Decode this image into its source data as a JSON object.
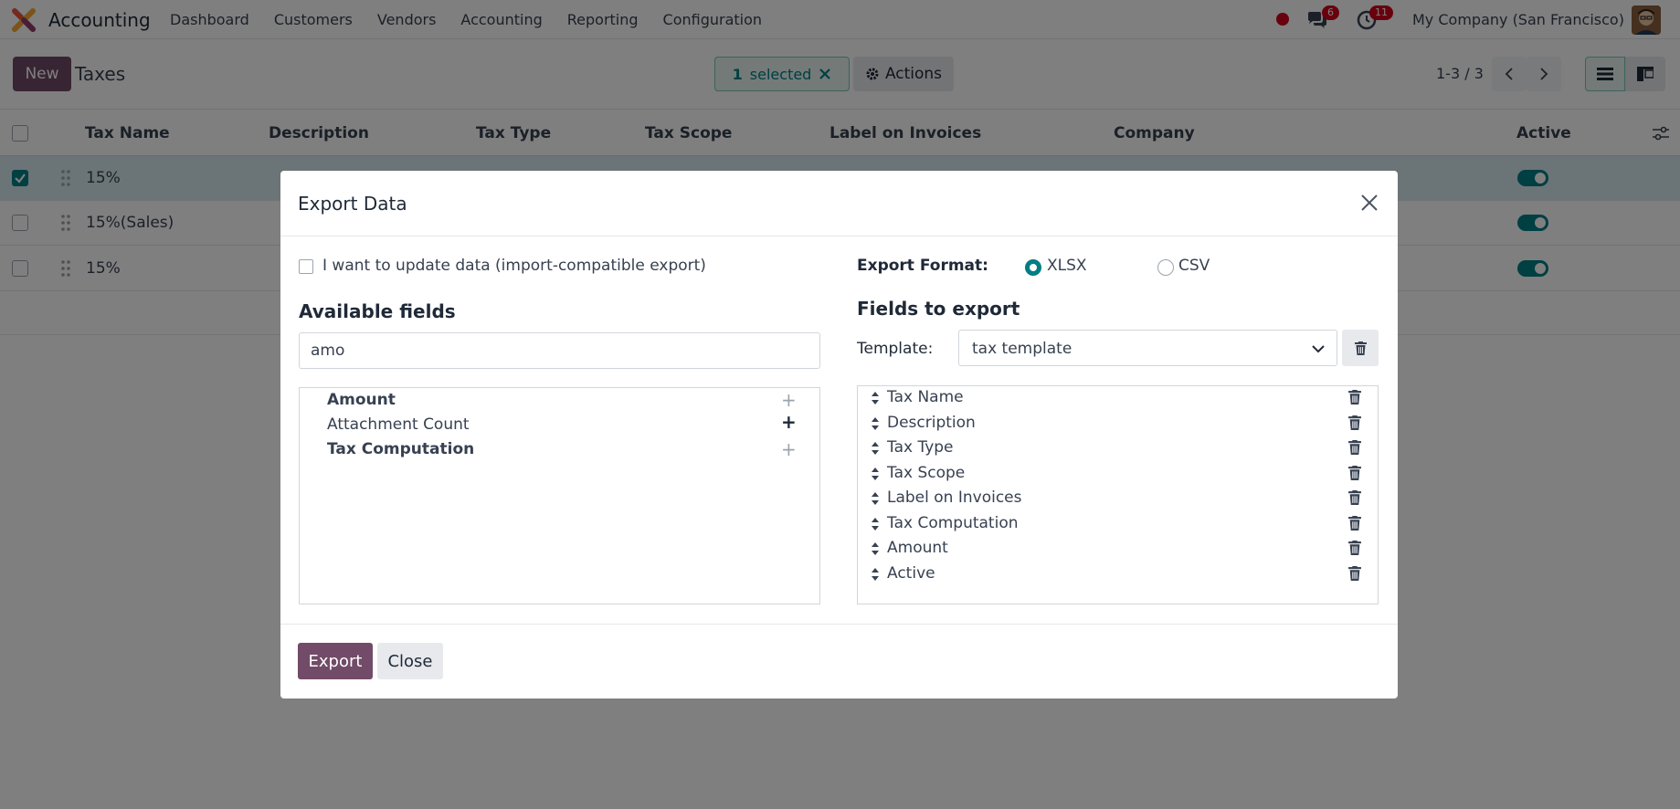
{
  "app": {
    "name": "Accounting",
    "logo_icon": "odoo-accounting-logo-icon",
    "menu": [
      "Dashboard",
      "Customers",
      "Vendors",
      "Accounting",
      "Reporting",
      "Configuration"
    ],
    "messages_badge": "6",
    "activities_badge": "11",
    "company": "My Company (San Francisco)",
    "status_color": "#d0021b"
  },
  "control": {
    "new_label": "New",
    "title": "Taxes",
    "selected_count": "1",
    "selected_text": "selected",
    "actions_label": "Actions",
    "pager": "1-3 / 3"
  },
  "table": {
    "columns": [
      "Tax Name",
      "Description",
      "Tax Type",
      "Tax Scope",
      "Label on Invoices",
      "Company",
      "Active"
    ],
    "rows": [
      {
        "name": "15%",
        "selected": true,
        "active": true
      },
      {
        "name": "15%(Sales)",
        "selected": false,
        "active": true
      },
      {
        "name": "15%",
        "selected": false,
        "active": true
      }
    ]
  },
  "modal": {
    "title": "Export Data",
    "import_compat_label": "I want to update data (import-compatible export)",
    "available_title": "Available fields",
    "search_value": "amo",
    "available_fields": [
      {
        "label": "Amount",
        "bold": true
      },
      {
        "label": "Attachment Count",
        "bold": false
      },
      {
        "label": "Tax Computation",
        "bold": true
      }
    ],
    "format_label": "Export Format:",
    "format_options": [
      "XLSX",
      "CSV"
    ],
    "format_selected": "XLSX",
    "fields_to_export_title": "Fields to export",
    "template_label": "Template:",
    "template_value": "tax template",
    "export_fields": [
      "Tax Name",
      "Description",
      "Tax Type",
      "Tax Scope",
      "Label on Invoices",
      "Tax Computation",
      "Amount",
      "Active"
    ],
    "export_button": "Export",
    "close_button": "Close"
  },
  "colors": {
    "brand": "#714b67",
    "accent": "#017e84",
    "badge": "#d0021b"
  }
}
